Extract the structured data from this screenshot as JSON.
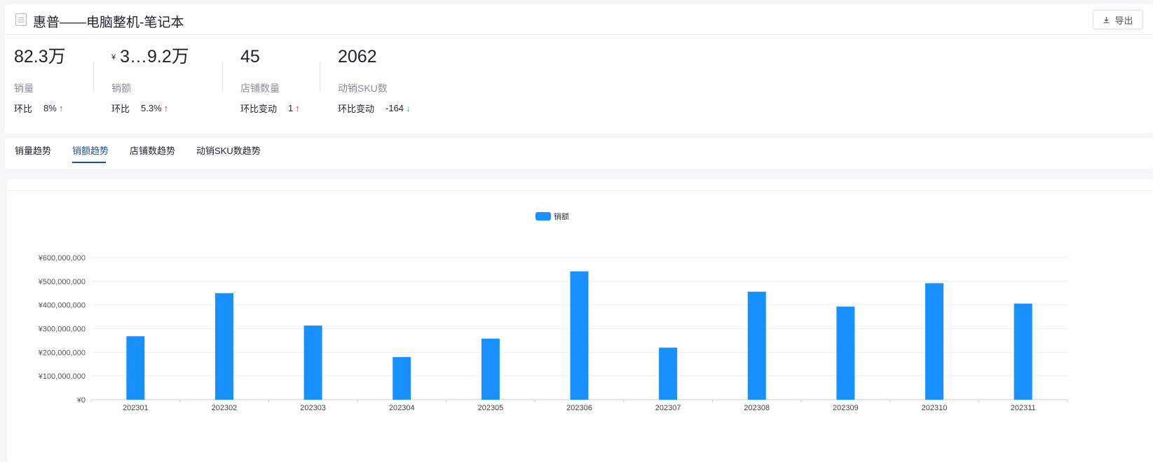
{
  "header": {
    "title": "惠普——电脑整机-笔记本",
    "export_label": "导出"
  },
  "metrics": [
    {
      "value": "82.3万",
      "label": "销量",
      "change_label": "环比",
      "change_value": "8%",
      "direction": "up"
    },
    {
      "currency": "¥",
      "value": "3…9.2万",
      "label": "销额",
      "change_label": "环比",
      "change_value": "5.3%",
      "direction": "up"
    },
    {
      "value": "45",
      "label": "店铺数量",
      "change_label": "环比变动",
      "change_value": "1",
      "direction": "up"
    },
    {
      "value": "2062",
      "label": "动销SKU数",
      "change_label": "环比变动",
      "change_value": "-164",
      "direction": "down"
    }
  ],
  "tabs": [
    {
      "label": "销量趋势",
      "active": false
    },
    {
      "label": "销额趋势",
      "active": true
    },
    {
      "label": "店铺数趋势",
      "active": false
    },
    {
      "label": "动销SKU数趋势",
      "active": false
    }
  ],
  "colors": {
    "bar": "#1890ff",
    "tab_active": "#1e4f9c",
    "arrow_up": "#f5222d",
    "arrow_down": "#1bbf56"
  },
  "chart_data": {
    "type": "bar",
    "categories": [
      "202301",
      "202302",
      "202303",
      "202304",
      "202305",
      "202306",
      "202307",
      "202308",
      "202309",
      "202310",
      "202311"
    ],
    "series": [
      {
        "name": "销额",
        "values": [
          268000000,
          450000000,
          313000000,
          180000000,
          258000000,
          542000000,
          220000000,
          456000000,
          393000000,
          492000000,
          406000000
        ]
      }
    ],
    "yticks": [
      "¥0",
      "¥100,000,000",
      "¥200,000,000",
      "¥300,000,000",
      "¥400,000,000",
      "¥500,000,000",
      "¥600,000,000"
    ],
    "ylim": [
      0,
      600000000
    ],
    "legend_position": "top-center",
    "grid": true
  }
}
